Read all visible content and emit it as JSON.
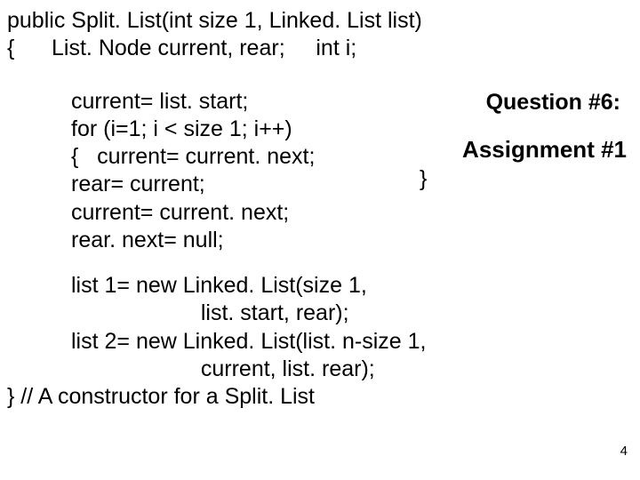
{
  "code": {
    "top1": "public Split. List(int size 1, Linked. List list)",
    "top2": "{      List. Node current, rear;     int i;",
    "b1": "current= list. start;",
    "b2": "for (i=1; i < size 1; i++)",
    "b3": "{   current= current. next;",
    "b4": "rear= current;",
    "b5": "current= current. next;",
    "b6": "rear. next= null;",
    "c1": "list 1= new Linked. List(size 1,",
    "c2": "                     list. start, rear);",
    "c3": "list 2= new Linked. List(list. n-size 1,",
    "c4": "                     current, list. rear);",
    "close": "} // A constructor for a Split. List"
  },
  "labels": {
    "question": "Question #6:",
    "assignment": "Assignment #1",
    "rbrace": "}",
    "pagenum": "4"
  }
}
